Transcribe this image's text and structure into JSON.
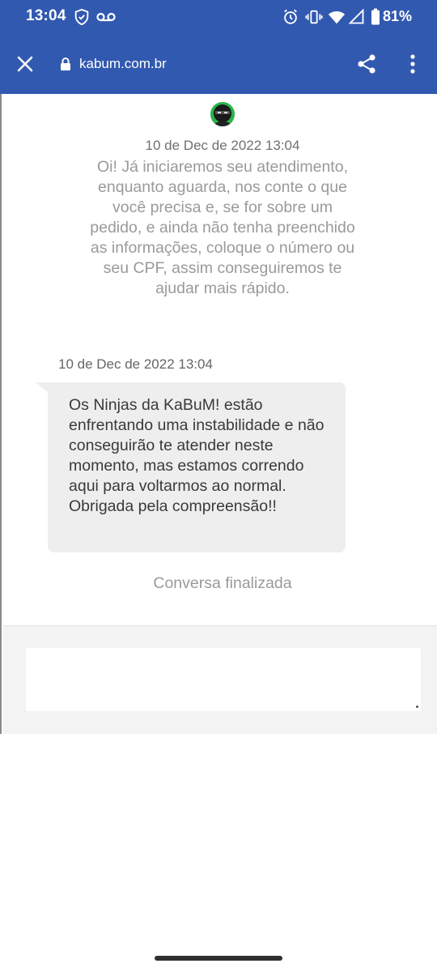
{
  "status_bar": {
    "time": "13:04",
    "battery_percent": "81%",
    "icons": [
      "shield-check-icon",
      "voicemail-icon",
      "alarm-icon",
      "vibrate-icon",
      "wifi-icon",
      "cell-signal-icon",
      "battery-icon"
    ]
  },
  "browser": {
    "url": "kabum.com.br",
    "icons": [
      "close-icon",
      "lock-icon",
      "share-icon",
      "more-vert-icon"
    ]
  },
  "chat": {
    "messages": [
      {
        "timestamp": "10 de Dec de 2022 13:04",
        "text": "Oi! Já iniciaremos seu atendimento, enquanto aguarda, nos conte o que você precisa e, se for sobre um pedido, e ainda não tenha preenchido as informações, coloque o número ou seu CPF, assim conseguiremos te ajudar mais rápido."
      },
      {
        "timestamp": "10 de Dec de 2022 13:04",
        "text": "Os Ninjas da KaBuM! estão enfrentando uma instabilidade e não conseguirão te atender neste momento, mas estamos correndo aqui para voltarmos ao normal. Obrigada pela compreensão!!"
      }
    ],
    "ended_label": "Conversa finalizada",
    "composer_value": ""
  },
  "colors": {
    "header_blue": "#3159b0",
    "avatar_green": "#29b34a",
    "bubble_gray": "#eeeeee"
  }
}
